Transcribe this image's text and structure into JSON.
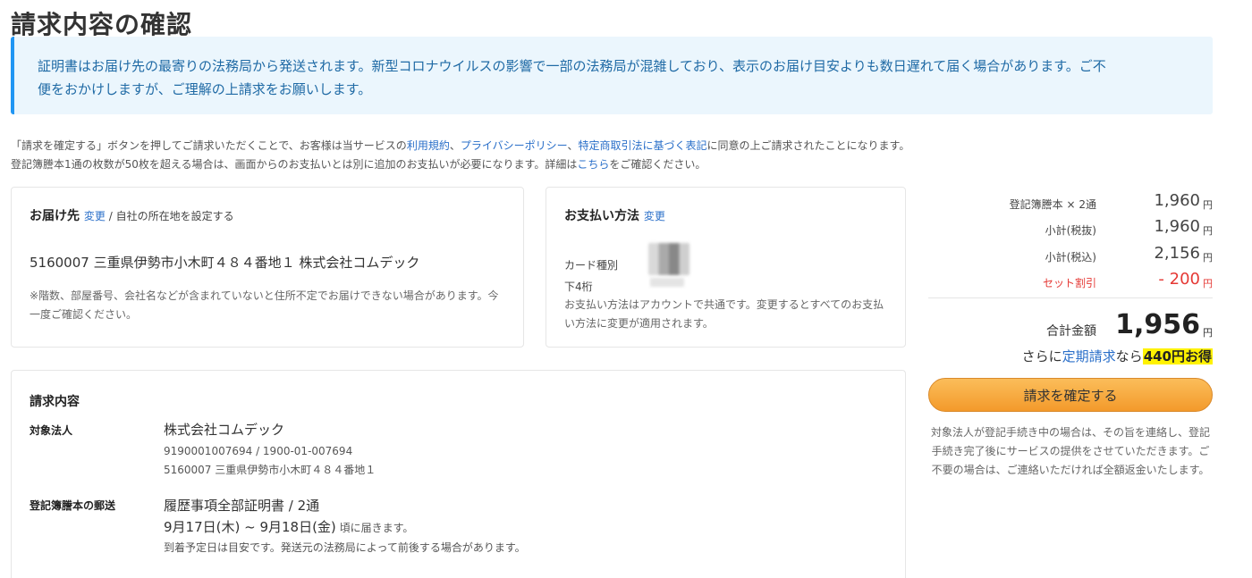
{
  "page": {
    "title": "請求内容の確認"
  },
  "notice": {
    "line1": "証明書はお届け先の最寄りの法務局から発送されます。新型コロナウイルスの影響で一部の法務局が混雑しており、表示のお届け目安よりも数日遅れて届く場合があります。ご不",
    "line2": "便をおかけしますが、ご理解の上請求をお願いします。"
  },
  "agreement": {
    "line1_pre": "「請求を確定する」ボタンを押してご請求いただくことで、お客様は当サービスの",
    "terms_link": "利用規約",
    "sep1": "、",
    "privacy_link": "プライバシーポリシー",
    "sep2": "、",
    "tokushoho_link": "特定商取引法に基づく表記",
    "line1_post": "に同意の上ご請求されたことになります。",
    "line2_pre": "登記簿謄本1通の枚数が50枚を超える場合は、画面からのお支払いとは別に追加のお支払いが必要になります。詳細は",
    "here_link": "こちら",
    "line2_post": "をご確認ください。"
  },
  "delivery": {
    "title": "お届け先",
    "change_link": "変更",
    "separator": " / ",
    "company_address_link": "自社の所在地を設定する",
    "address": "5160007 三重県伊勢市小木町４８４番地１ 株式会社コムデック",
    "warning": "※階数、部屋番号、会社名などが含まれていないと住所不定でお届けできない場合があります。今一度ご確認ください。"
  },
  "payment": {
    "title": "お支払い方法",
    "change_link": "変更",
    "card_type_label": "カード種別",
    "last4_label": "下4桁",
    "note": "お支払い方法はアカウントで共通です。変更するとすべてのお支払い方法に変更が適用されます。"
  },
  "details": {
    "title": "請求内容",
    "entity_label": "対象法人",
    "entity_name": "株式会社コムデック",
    "entity_ids": "9190001007694 / 1900-01-007694",
    "entity_address": "5160007 三重県伊勢市小木町４８４番地１",
    "mail_label": "登記簿謄本の郵送",
    "mail_item": "履歴事項全部証明書 / 2通",
    "mail_date": "9月17日(木) ~ 9月18日(金)",
    "mail_date_suffix": " 頃に届きます。",
    "mail_note": "到着予定日は目安です。発送元の法務局によって前後する場合があります。"
  },
  "summary": {
    "rows": [
      {
        "label": "登記簿謄本 × 2通",
        "value": "1,960",
        "unit": "円"
      },
      {
        "label": "小計(税抜)",
        "value": "1,960",
        "unit": "円"
      },
      {
        "label": "小計(税込)",
        "value": "2,156",
        "unit": "円"
      },
      {
        "label": "セット割引",
        "value": "- 200",
        "unit": "円"
      }
    ],
    "total_label": "合計金額",
    "total_value": "1,956",
    "total_unit": "円",
    "promo_pre": "さらに",
    "promo_link": "定期請求",
    "promo_mid": "なら",
    "promo_highlight": "440円お得",
    "confirm_button": "請求を確定する",
    "confirm_note": "対象法人が登記手続き中の場合は、その旨を連絡し、登記手続き完了後にサービスの提供をさせていただきます。ご不要の場合は、ご連絡いただければ全額返金いたします。"
  },
  "colors": {
    "link": "#2a6fc9",
    "notice_bg": "#ebf6fd",
    "notice_border": "#2196f3",
    "discount": "#e53935",
    "button": "#f5a53a",
    "highlight": "#fff200"
  }
}
